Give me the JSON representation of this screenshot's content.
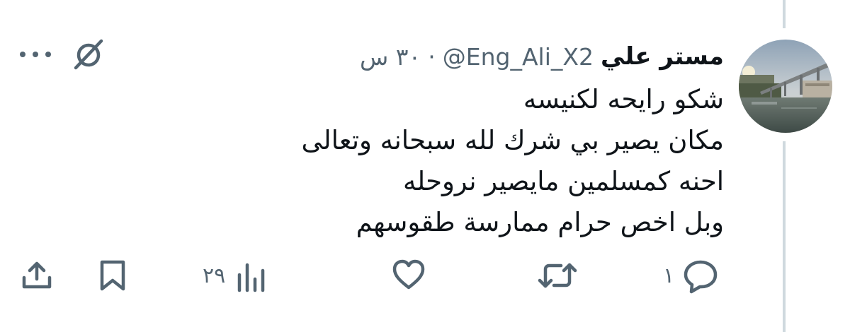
{
  "tweet": {
    "author_name": "مستر علي",
    "handle": "@Eng_Ali_X2",
    "separator": "·",
    "time": "٣٠ س",
    "lines": [
      "شكو رايحه لكنيسه",
      "مكان يصير بي شرك لله سبحانه وتعالى",
      "احنه كمسلمين مايصير نروحله",
      "وبل اخص حرام ممارسة طقوسهم"
    ]
  },
  "actions": {
    "replies": "١",
    "views": "٢٩"
  },
  "icons": [
    "more-icon",
    "grok-icon",
    "share-icon",
    "bookmark-icon",
    "views-icon",
    "like-icon",
    "retweet-icon",
    "reply-icon"
  ],
  "colors": {
    "text": "#0f1419",
    "secondary": "#536471",
    "thread_line": "#cfd9de"
  }
}
